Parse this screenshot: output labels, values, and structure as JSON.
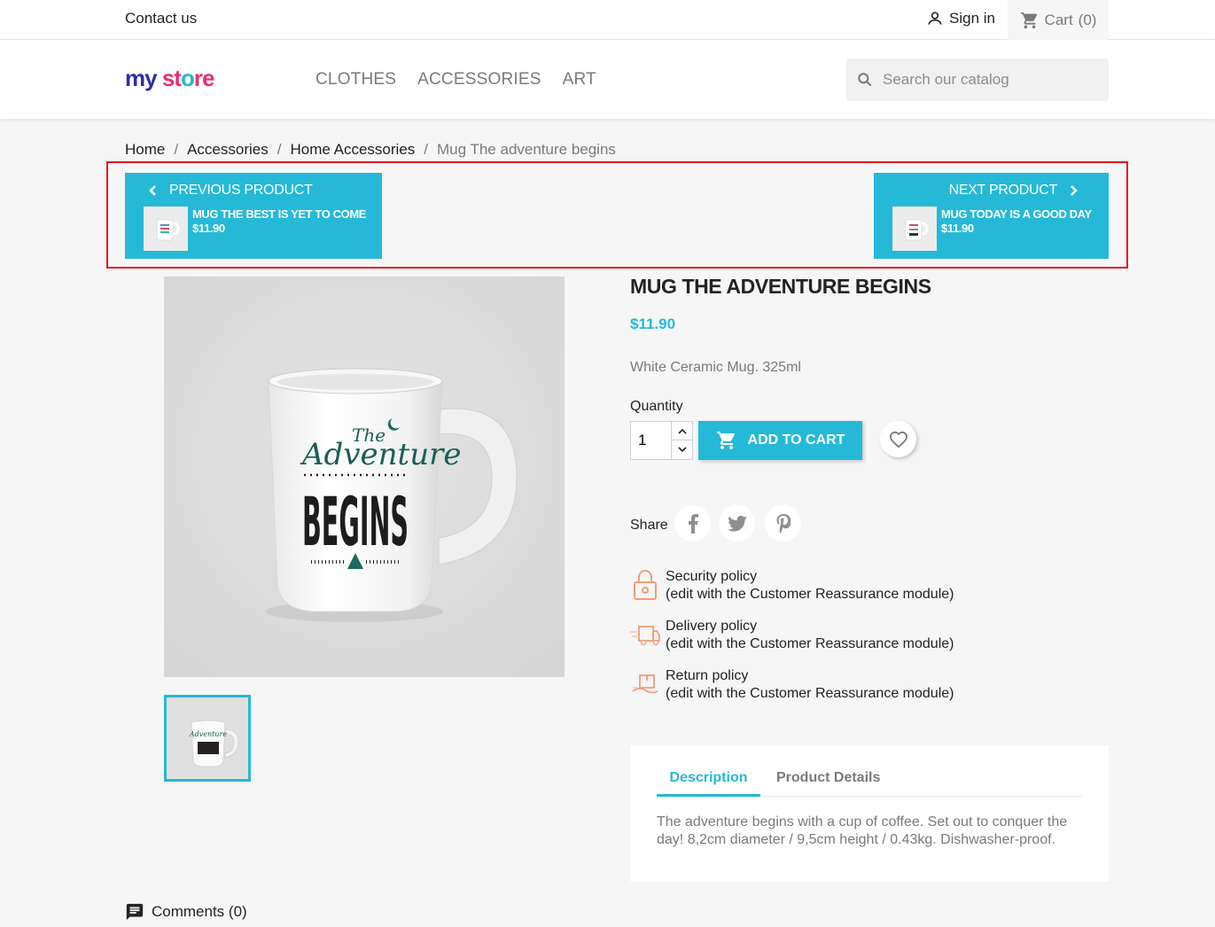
{
  "topbar": {
    "contact": "Contact us",
    "signin": "Sign in",
    "cart": "Cart",
    "cart_count": "(0)"
  },
  "header": {
    "logo_my": "my",
    "logo_store_1": "st",
    "logo_store_2": "o",
    "logo_store_3": "re",
    "nav": [
      "CLOTHES",
      "ACCESSORIES",
      "ART"
    ],
    "search_placeholder": "Search our catalog"
  },
  "breadcrumb": {
    "items": [
      "Home",
      "Accessories",
      "Home Accessories"
    ],
    "current": "Mug The adventure begins",
    "separator": "/"
  },
  "product_nav": {
    "prev": {
      "label": "PREVIOUS PRODUCT",
      "name": "MUG THE BEST IS YET TO COME",
      "price": "$11.90"
    },
    "next": {
      "label": "NEXT PRODUCT",
      "name": "MUG TODAY IS A GOOD DAY",
      "price": "$11.90"
    }
  },
  "product": {
    "title": "MUG THE ADVENTURE BEGINS",
    "price": "$11.90",
    "short_description": "White Ceramic Mug. 325ml",
    "quantity_label": "Quantity",
    "quantity_value": "1",
    "add_to_cart": "ADD TO CART",
    "share_label": "Share",
    "mug_text_the": "The",
    "mug_text_adventure": "Adventure",
    "mug_text_begins": "BEGINS"
  },
  "reassurance": [
    {
      "title": "Security policy",
      "detail": "(edit with the Customer Reassurance module)",
      "icon": "lock-icon"
    },
    {
      "title": "Delivery policy",
      "detail": "(edit with the Customer Reassurance module)",
      "icon": "truck-icon"
    },
    {
      "title": "Return policy",
      "detail": "(edit with the Customer Reassurance module)",
      "icon": "return-box-icon"
    }
  ],
  "tabs": {
    "description": "Description",
    "details": "Product Details",
    "description_text": "The adventure begins with a cup of coffee. Set out to conquer the day! 8,2cm diameter / 9,5cm height / 0.43kg. Dishwasher-proof."
  },
  "comments": {
    "label": "Comments (0)"
  },
  "colors": {
    "accent": "#25b9d7",
    "highlight_border": "#e3141b"
  }
}
